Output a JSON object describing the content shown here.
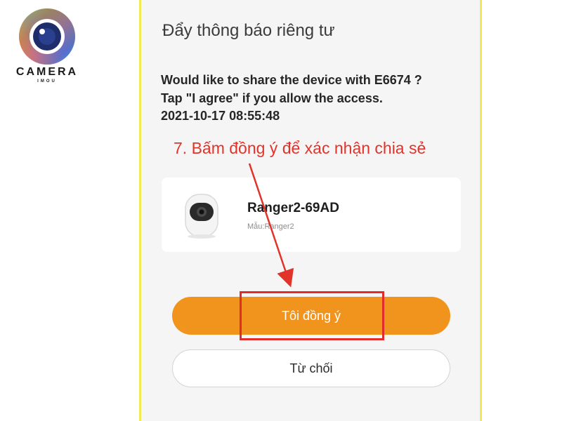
{
  "brand": {
    "title": "CAMERA",
    "subtitle": "IMOU",
    "colors": {
      "ring_outer": "#e63a8b",
      "ring_lens": "#1f2d6b"
    }
  },
  "screen": {
    "title": "Đẩy thông báo riêng tư",
    "message_lines": [
      "Would like to share the device with E6674 ?",
      "Tap \"I agree\" if you allow the access.",
      "2021-10-17 08:55:48"
    ],
    "annotation": "7. Bấm đồng ý để xác nhận chia sẻ",
    "device": {
      "name": "Ranger2-69AD",
      "model": "Mẫu:Ranger2",
      "icon": "camera-device-icon"
    },
    "buttons": {
      "agree_label": "Tôi đồng ý",
      "decline_label": "Từ chối"
    }
  },
  "colors": {
    "accent_orange": "#f0941d",
    "annotation_red": "#e2332a",
    "screen_border": "#f1ea52"
  }
}
